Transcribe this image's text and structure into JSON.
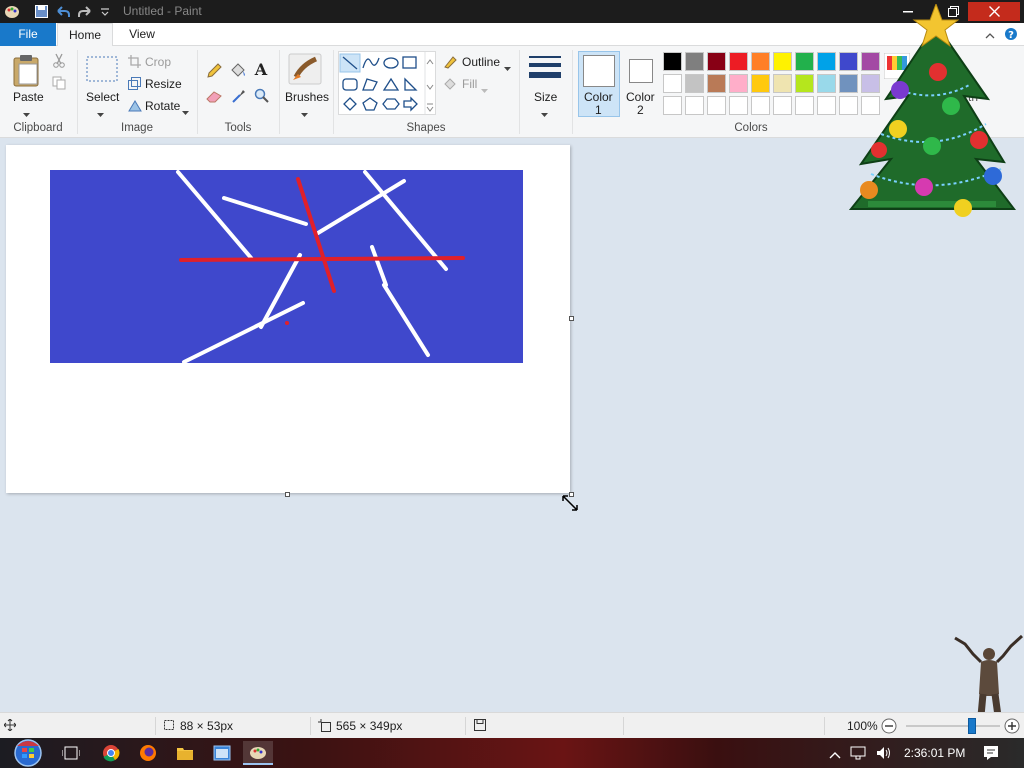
{
  "window": {
    "title": "Untitled - Paint",
    "buttons": [
      "minimize",
      "restore",
      "close"
    ]
  },
  "tabs": [
    {
      "label": "File"
    },
    {
      "label": "Home"
    },
    {
      "label": "View"
    }
  ],
  "ribbon": {
    "clipboard": {
      "paste": "Paste",
      "group": "Clipboard"
    },
    "image": {
      "select": "Select",
      "crop": "Crop",
      "resize": "Resize",
      "rotate": "Rotate",
      "group": "Image"
    },
    "tools": {
      "group": "Tools"
    },
    "brushes": {
      "label": "Brushes"
    },
    "shapes": {
      "outline": "Outline",
      "fill": "Fill",
      "group": "Shapes"
    },
    "size": {
      "label": "Size"
    },
    "color1": {
      "line1": "Color",
      "line2": "1"
    },
    "color2": {
      "line1": "Color",
      "line2": "2"
    },
    "colors": {
      "group": "Colors"
    },
    "edit_colors_partial": "th"
  },
  "palette": {
    "row1": [
      "#000000",
      "#7f7f7f",
      "#880015",
      "#ed1c24",
      "#ff7f27",
      "#fff200",
      "#22b14c",
      "#00a2e8",
      "#3f48cc",
      "#a349a4"
    ],
    "row2": [
      "#ffffff",
      "#c3c3c3",
      "#b97a57",
      "#ffaec9",
      "#ffc90e",
      "#efe4b0",
      "#b5e61d",
      "#99d9ea",
      "#7092be",
      "#c8bfe7"
    ],
    "row3": [
      "#ffffff",
      "#ffffff",
      "#ffffff",
      "#ffffff",
      "#ffffff",
      "#ffffff",
      "#ffffff",
      "#ffffff",
      "#ffffff",
      "#ffffff"
    ]
  },
  "colors": {
    "color1": "#ffffff",
    "color2": "#ffffff",
    "drawing_background": "#3f48cc",
    "stroke_white": "#ffffff",
    "stroke_red": "#e0202a",
    "ribbon_accent": "#1979ca"
  },
  "statusbar": {
    "selection_size": "88 × 53px",
    "image_size": "565 × 349px",
    "zoom": "100%",
    "zoom_fraction": 0.7
  },
  "taskbar": {
    "apps": [
      "start-orb",
      "task-view",
      "chrome",
      "firefox",
      "file-explorer",
      "app-window",
      "paint"
    ],
    "clock": "2:36:01 PM"
  },
  "decorations": [
    "christmas-tree",
    "dancing-figure"
  ]
}
